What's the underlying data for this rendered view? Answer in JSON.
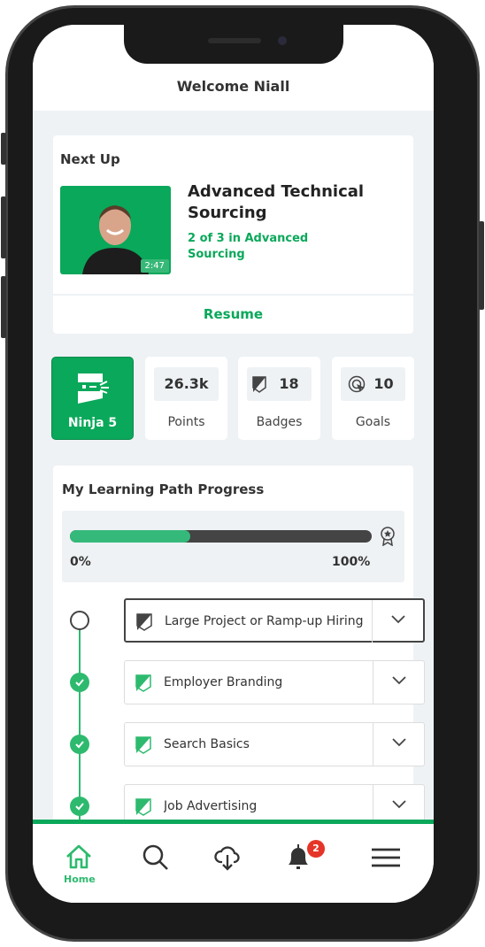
{
  "header": {
    "title": "Welcome Niall"
  },
  "next_up": {
    "heading": "Next Up",
    "title": "Advanced Technical Sourcing",
    "subtitle": "2 of 3 in Advanced Sourcing",
    "duration": "2:47",
    "resume_label": "Resume"
  },
  "stats": [
    {
      "label": "Ninja 5",
      "icon": "ninja-icon"
    },
    {
      "value": "26.3k",
      "label": "Points"
    },
    {
      "value": "18",
      "label": "Badges",
      "icon": "badge-icon"
    },
    {
      "value": "10",
      "label": "Goals",
      "icon": "target-icon"
    }
  ],
  "learning_path": {
    "heading": "My Learning Path Progress",
    "progress_percent": 40,
    "min_label": "0%",
    "max_label": "100%",
    "items": [
      {
        "title": "Large Project or Ramp-up Hiring",
        "completed": false
      },
      {
        "title": "Employer Branding",
        "completed": true
      },
      {
        "title": "Search Basics",
        "completed": true
      },
      {
        "title": "Job Advertising",
        "completed": true
      }
    ]
  },
  "nav": {
    "items": [
      {
        "label": "Home",
        "icon": "home-icon",
        "active": true
      },
      {
        "icon": "search-icon"
      },
      {
        "icon": "cloud-download-icon"
      },
      {
        "icon": "bell-icon",
        "badge": "2"
      },
      {
        "icon": "menu-icon"
      }
    ]
  },
  "colors": {
    "accent": "#0aa85a",
    "progress": "#35b97a",
    "bar": "#444444",
    "badge": "#e53528"
  }
}
